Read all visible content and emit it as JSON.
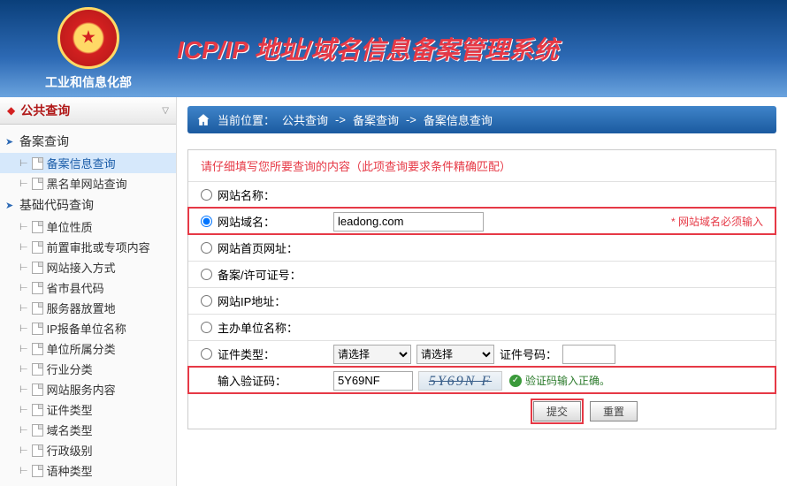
{
  "header": {
    "ministry": "工业和信息化部",
    "title": "ICP/IP 地址/域名信息备案管理系统"
  },
  "sidebar": {
    "section": "公共查询",
    "group1": "备案查询",
    "items1": [
      "备案信息查询",
      "黑名单网站查询"
    ],
    "group2": "基础代码查询",
    "items2": [
      "单位性质",
      "前置审批或专项内容",
      "网站接入方式",
      "省市县代码",
      "服务器放置地",
      "IP报备单位名称",
      "单位所属分类",
      "行业分类",
      "网站服务内容",
      "证件类型",
      "域名类型",
      "行政级别",
      "语种类型"
    ]
  },
  "breadcrumb": {
    "label": "当前位置：",
    "p1": "公共查询",
    "sep": "->",
    "p2": "备案查询",
    "p3": "备案信息查询"
  },
  "form": {
    "hint": "请仔细填写您所要查询的内容（此项查询要求条件精确匹配）",
    "fields": {
      "site_name": "网站名称：",
      "domain": "网站域名：",
      "homepage": "网站首页网址：",
      "license": "备案/许可证号：",
      "ip": "网站IP地址：",
      "sponsor": "主办单位名称：",
      "cert_type": "证件类型：",
      "cert_no": "证件号码：",
      "captcha": "输入验证码："
    },
    "values": {
      "domain": "leadong.com",
      "captcha": "5Y69NF"
    },
    "select_placeholder": "请选择",
    "required_note": "* 网站域名必须输入",
    "captcha_img": "5Y69N F",
    "captcha_ok": "验证码输入正确。",
    "submit": "提交",
    "reset": "重置"
  }
}
